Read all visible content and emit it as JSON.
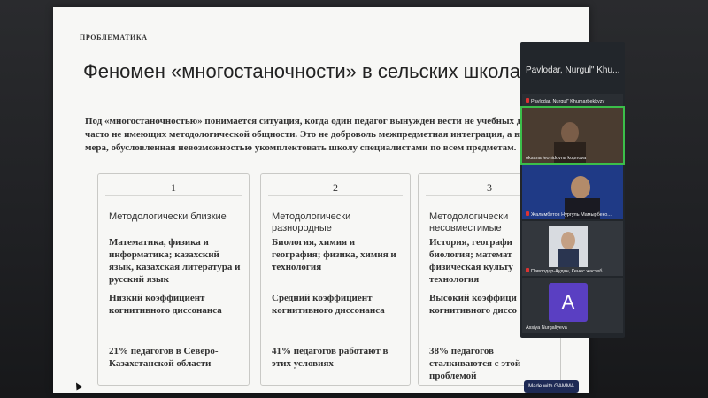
{
  "slide": {
    "kicker": "ПРОБЛЕМАТИКА",
    "title": "Феномен «многостаночности» в сельских школах",
    "intro": "Под «многостаночностью» понимается ситуация, когда один педагог вынужден вести не учебных дисциплин, часто не имеющих методологической общности. Это не доброволь межпредметная интеграция, а вынужденная мера, обусловленная невозможностью укомплектовать школу специалистами по всем предметам.",
    "cards": [
      {
        "num": "1",
        "head": "Методологически близкие",
        "subjects": "Математика, физика и информатика; казахский язык, казахская литература и русский язык",
        "coef": "Низкий коэффициент когнитивного диссонанса",
        "stat": "21% педагогов в Северо-Казахстанской области"
      },
      {
        "num": "2",
        "head": "Методологически разнородные",
        "subjects": "Биология, химия и география; физика, химия и технология",
        "coef": "Средний коэффициент когнитивного диссонанса",
        "stat": "41% педагогов работают в этих условиях"
      },
      {
        "num": "3",
        "head": "Методологически несовместимые",
        "subjects": "История, географи биология; математ физическая культу технология",
        "coef": "Высокий коэффици когнитивного диссо",
        "stat": "38% педагогов сталкиваются с этой проблемой"
      }
    ],
    "badge": "Made with GAMMA"
  },
  "participants": {
    "header": "Pavlodar, Nurgul\" Khu...",
    "tiles": [
      {
        "name": "Pavlodar, Nurgul\" Khumarbekkyzy"
      },
      {
        "name": "oksana leonidovna kopnova"
      },
      {
        "name": "Жалимбетов Нургуль Мамырбеко..."
      },
      {
        "name": "Павлодар-Аудан, Кенес жастеб..."
      },
      {
        "name": "Assiya Nurgaliyeva",
        "initial": "A"
      }
    ]
  },
  "colors": {
    "active_outline": "#3bbf4a",
    "avatar": "#5a3fc2",
    "badge": "#1e2a55"
  }
}
